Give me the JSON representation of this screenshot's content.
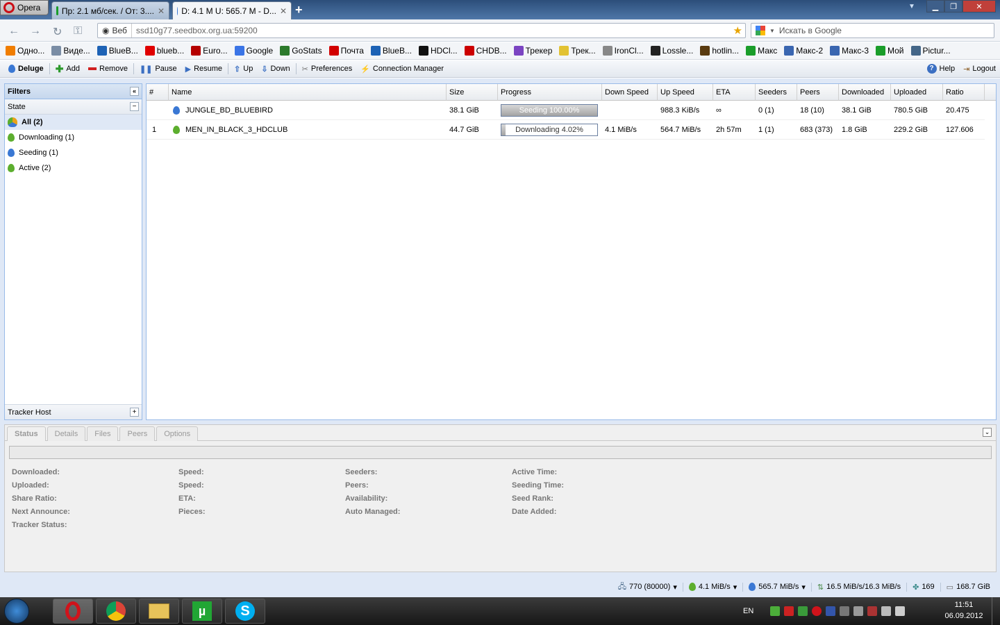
{
  "browser": {
    "opera_label": "Opera",
    "tabs": [
      {
        "title": "Пр: 2.1 мб/сек. / От: 3...."
      },
      {
        "title": "D: 4.1 M U: 565.7 M - D..."
      }
    ],
    "address_prefix": "Веб",
    "url": "ssd10g77.seedbox.org.ua:59200",
    "search_placeholder": "Искать в Google"
  },
  "bookmarks": [
    {
      "label": "Одно...",
      "color": "#f07d00"
    },
    {
      "label": "Виде...",
      "color": "#7a8da5"
    },
    {
      "label": "BlueB...",
      "color": "#1d62b5"
    },
    {
      "label": "blueb...",
      "color": "#e00000"
    },
    {
      "label": "Euro...",
      "color": "#b50000"
    },
    {
      "label": "Google",
      "color": "#3a74e6"
    },
    {
      "label": "GoStats",
      "color": "#2c7a2c"
    },
    {
      "label": "Почта",
      "color": "#d20000"
    },
    {
      "label": "BlueB...",
      "color": "#1d62b5"
    },
    {
      "label": "HDCl...",
      "color": "#111111"
    },
    {
      "label": "CHDB...",
      "color": "#cc0000"
    },
    {
      "label": "Трекер",
      "color": "#7b44c2"
    },
    {
      "label": "Трек...",
      "color": "#e2c233"
    },
    {
      "label": "IronCl...",
      "color": "#888888"
    },
    {
      "label": "Lossle...",
      "color": "#222222"
    },
    {
      "label": "hotlin...",
      "color": "#5a3b10"
    },
    {
      "label": "Макс",
      "color": "#1a9d2a"
    },
    {
      "label": "Макс-2",
      "color": "#3a66b0"
    },
    {
      "label": "Макс-3",
      "color": "#3a66b0"
    },
    {
      "label": "Мой",
      "color": "#1a9d2a"
    },
    {
      "label": "Pictur...",
      "color": "#446688"
    }
  ],
  "toolbar": {
    "deluge": "Deluge",
    "add": "Add",
    "remove": "Remove",
    "pause": "Pause",
    "resume": "Resume",
    "up": "Up",
    "down": "Down",
    "preferences": "Preferences",
    "connection_manager": "Connection Manager",
    "help": "Help",
    "logout": "Logout"
  },
  "filters": {
    "title": "Filters",
    "state_label": "State",
    "items": [
      {
        "label": "All (2)"
      },
      {
        "label": "Downloading (1)"
      },
      {
        "label": "Seeding (1)"
      },
      {
        "label": "Active (2)"
      }
    ],
    "tracker_host": "Tracker Host"
  },
  "grid": {
    "columns": [
      "#",
      "Name",
      "Size",
      "Progress",
      "Down Speed",
      "Up Speed",
      "ETA",
      "Seeders",
      "Peers",
      "Downloaded",
      "Uploaded",
      "Ratio"
    ],
    "rows": [
      {
        "num": "",
        "name": "JUNGLE_BD_BLUEBIRD",
        "size": "38.1 GiB",
        "progress_text": "Seeding 100.00%",
        "progress": 1.0,
        "down": "",
        "up": "988.3 KiB/s",
        "eta": "∞",
        "seeders": "0 (1)",
        "peers": "18 (10)",
        "downloaded": "38.1 GiB",
        "uploaded": "780.5 GiB",
        "ratio": "20.475",
        "state": "seeding"
      },
      {
        "num": "1",
        "name": "MEN_IN_BLACK_3_HDCLUB",
        "size": "44.7 GiB",
        "progress_text": "Downloading 4.02%",
        "progress": 0.0402,
        "down": "4.1 MiB/s",
        "up": "564.7 MiB/s",
        "eta": "2h 57m",
        "seeders": "1 (1)",
        "peers": "683 (373)",
        "downloaded": "1.8 GiB",
        "uploaded": "229.2 GiB",
        "ratio": "127.606",
        "state": "downloading"
      }
    ]
  },
  "details": {
    "tabs": [
      "Status",
      "Details",
      "Files",
      "Peers",
      "Options"
    ],
    "labels": [
      [
        "Downloaded:",
        "Uploaded:",
        "Share Ratio:",
        "Next Announce:",
        "Tracker Status:"
      ],
      [
        "Speed:",
        "Speed:",
        "ETA:",
        "Pieces:"
      ],
      [
        "Seeders:",
        "Peers:",
        "Availability:",
        "Auto Managed:"
      ],
      [
        "Active Time:",
        "Seeding Time:",
        "Seed Rank:",
        "Date Added:"
      ]
    ]
  },
  "statusbar": {
    "connections": "770 (80000)",
    "down": "4.1 MiB/s",
    "up": "565.7 MiB/s",
    "protocol": "16.5 MiB/s/16.3 MiB/s",
    "dht": "169",
    "free_space": "168.7 GiB"
  },
  "taskbar": {
    "lang": "EN",
    "time": "11:51",
    "date": "06.09.2012"
  }
}
